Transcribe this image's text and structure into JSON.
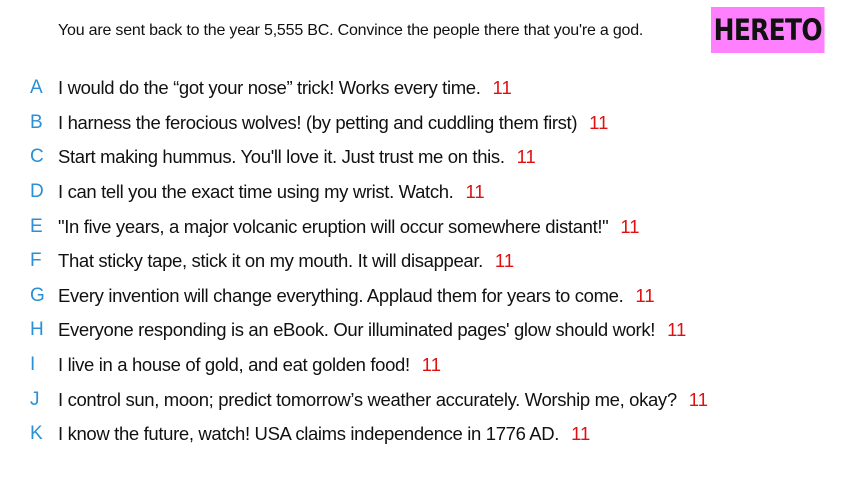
{
  "header": {
    "prompt": "You are sent back to the year 5,555 BC. Convince the people there that you're a god.",
    "badge": "HERETO"
  },
  "colors": {
    "badge_bg": "#ff80ff",
    "letter": "#2a8fd6",
    "score": "#e01010"
  },
  "answers": [
    {
      "letter": "A",
      "text": "I would do the “got your nose” trick! Works every time.",
      "score": "11"
    },
    {
      "letter": "B",
      "text": "I harness the ferocious wolves! (by petting and cuddling them first)",
      "score": "11"
    },
    {
      "letter": "C",
      "text": "Start making hummus. You'll love it. Just trust me on this.",
      "score": "11"
    },
    {
      "letter": "D",
      "text": "I can tell you the exact time using my wrist. Watch.",
      "score": "11"
    },
    {
      "letter": "E",
      "text": "\"In five years, a major volcanic eruption will occur somewhere distant!\"",
      "score": "11"
    },
    {
      "letter": "F",
      "text": "That sticky tape, stick it on my mouth. It will disappear.",
      "score": "11"
    },
    {
      "letter": "G",
      "text": "Every invention will change everything. Applaud them for years to come.",
      "score": "11"
    },
    {
      "letter": "H",
      "text": "Everyone responding is an eBook. Our illuminated pages' glow should work!",
      "score": "11"
    },
    {
      "letter": "I",
      "text": "I live in a house of gold, and eat golden food!",
      "score": "11"
    },
    {
      "letter": "J",
      "text": "I control sun, moon; predict tomorrow’s weather accurately. Worship me, okay?",
      "score": "11"
    },
    {
      "letter": "K",
      "text": "I know the future, watch! USA claims independence in 1776 AD.",
      "score": "11"
    }
  ]
}
